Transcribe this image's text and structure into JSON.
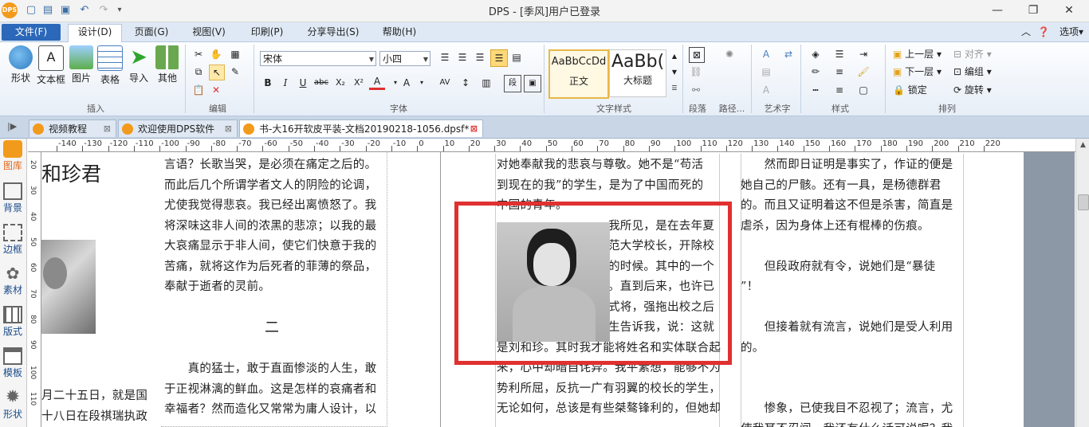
{
  "window": {
    "title": "DPS - [季风]用户已登录"
  },
  "quick_access": {
    "new": "new-icon",
    "open": "open-icon",
    "save": "save-icon",
    "undo": "undo-icon",
    "redo": "redo-icon"
  },
  "menu": {
    "file": "文件(F)",
    "design": "设计(D)",
    "page": "页面(G)",
    "view": "视图(V)",
    "print": "印刷(P)",
    "share": "分享导出(S)",
    "help": "帮助(H)",
    "options": "选项"
  },
  "ribbon": {
    "insert_group": "插入",
    "insert_buttons": [
      "形状",
      "文本框",
      "图片",
      "表格",
      "导入",
      "其他"
    ],
    "edit_group": "编辑",
    "font_group": "字体",
    "font_name": "宋体",
    "font_size": "小四",
    "text_style_group": "文字样式",
    "styles": [
      {
        "sample": "AaBbCcDd",
        "label": "正文"
      },
      {
        "sample": "AaBb(",
        "label": "大标题"
      }
    ],
    "paragraph_group": "段落",
    "path_group": "路径...",
    "art_group": "艺术字",
    "style_group": "样式",
    "arrange_group": "排列",
    "arrange": {
      "up": "上一层",
      "down": "下一层",
      "lock": "锁定",
      "align": "对齐",
      "group": "编组",
      "rotate": "旋转"
    }
  },
  "tabs": [
    {
      "label": "视频教程"
    },
    {
      "label": "欢迎使用DPS软件"
    },
    {
      "label": "书-大16开软皮平装-文档20190218-1056.dpsf*"
    }
  ],
  "sidebar": [
    {
      "label": "图库"
    },
    {
      "label": "背景"
    },
    {
      "label": "边框"
    },
    {
      "label": "素材"
    },
    {
      "label": "版式"
    },
    {
      "label": "模板"
    },
    {
      "label": "形状"
    }
  ],
  "ruler": {
    "h_ticks": [
      "-140",
      "-130",
      "-120",
      "-110",
      "-100",
      "-90",
      "-80",
      "-70",
      "-60",
      "-50",
      "-40",
      "-30",
      "-20",
      "-10",
      "0",
      "10",
      "20",
      "30",
      "40",
      "50",
      "60",
      "70",
      "80",
      "90",
      "100",
      "110",
      "120",
      "130",
      "140",
      "150",
      "160",
      "170",
      "180",
      "190",
      "200",
      "210",
      "220"
    ],
    "v_ticks": [
      "20",
      "30",
      "40",
      "50",
      "60",
      "70",
      "80",
      "90",
      "100",
      "110"
    ]
  },
  "page_left": {
    "heading": "和珍君",
    "col1_bottom": [
      "月二十五日，就是国",
      "十八日在段祺瑞执政"
    ],
    "col2_top": [
      "言语？长歌当哭，是必须在痛定之后的。",
      "而此后几个所谓学者文人的阴险的论调，",
      "尤使我觉得悲哀。我已经出离愤怒了。我",
      "将深味这非人间的浓黑的悲凉；以我的最",
      "大哀痛显示于非人间，使它们快意于我的",
      "苦痛，就将这作为后死者的菲薄的祭品，",
      "奉献于逝者的灵前。"
    ],
    "section_title": "二",
    "col2_bottom": [
      "　　真的猛士，敢于直面惨淡的人生，敢",
      "于正视淋漓的鲜血。这是怎样的哀痛者和",
      "幸福者？然而造化又常常为庸人设计，以"
    ]
  },
  "page_right": {
    "col1": [
      "对她奉献我的悲哀与尊敬。她不是“苟活",
      "到现在的我”的学生，是为了中国而死的",
      "中国的青年。",
      "我所见，是在去年夏",
      "范大学校长，开除校",
      "的时候。其中的一个",
      "。直到后来，也许已",
      "式将，强拖出校之后",
      "生告诉我，说：这就",
      "是刘和珍。其时我才能将姓名和实体联合起",
      "来，心中却暗自诧异。我平素想，能够不为",
      "势利所屈，反抗一广有羽翼的校长的学生，",
      "无论如何，总该是有些桀骜锋利的，但她却"
    ],
    "col2": [
      "　　然而即日证明是事实了，作证的便是",
      "她自己的尸骸。还有一具，是杨德群君",
      "的。而且又证明着这不但是杀害，简直是",
      "虐杀，因为身体上还有棍棒的伤痕。",
      "",
      "　　但段政府就有令，说她们是“暴徒",
      "”！",
      "",
      "　　但接着就有流言，说她们是受人利用",
      "的。",
      "",
      "",
      "　　惨象，已使我目不忍视了；流言，尤",
      "使我耳不忍闻。我还有什么话可说呢？我"
    ]
  },
  "colors": {
    "accent": "#2b68b9",
    "highlight": "#e03030",
    "ribbon": "#dfe9f5"
  }
}
